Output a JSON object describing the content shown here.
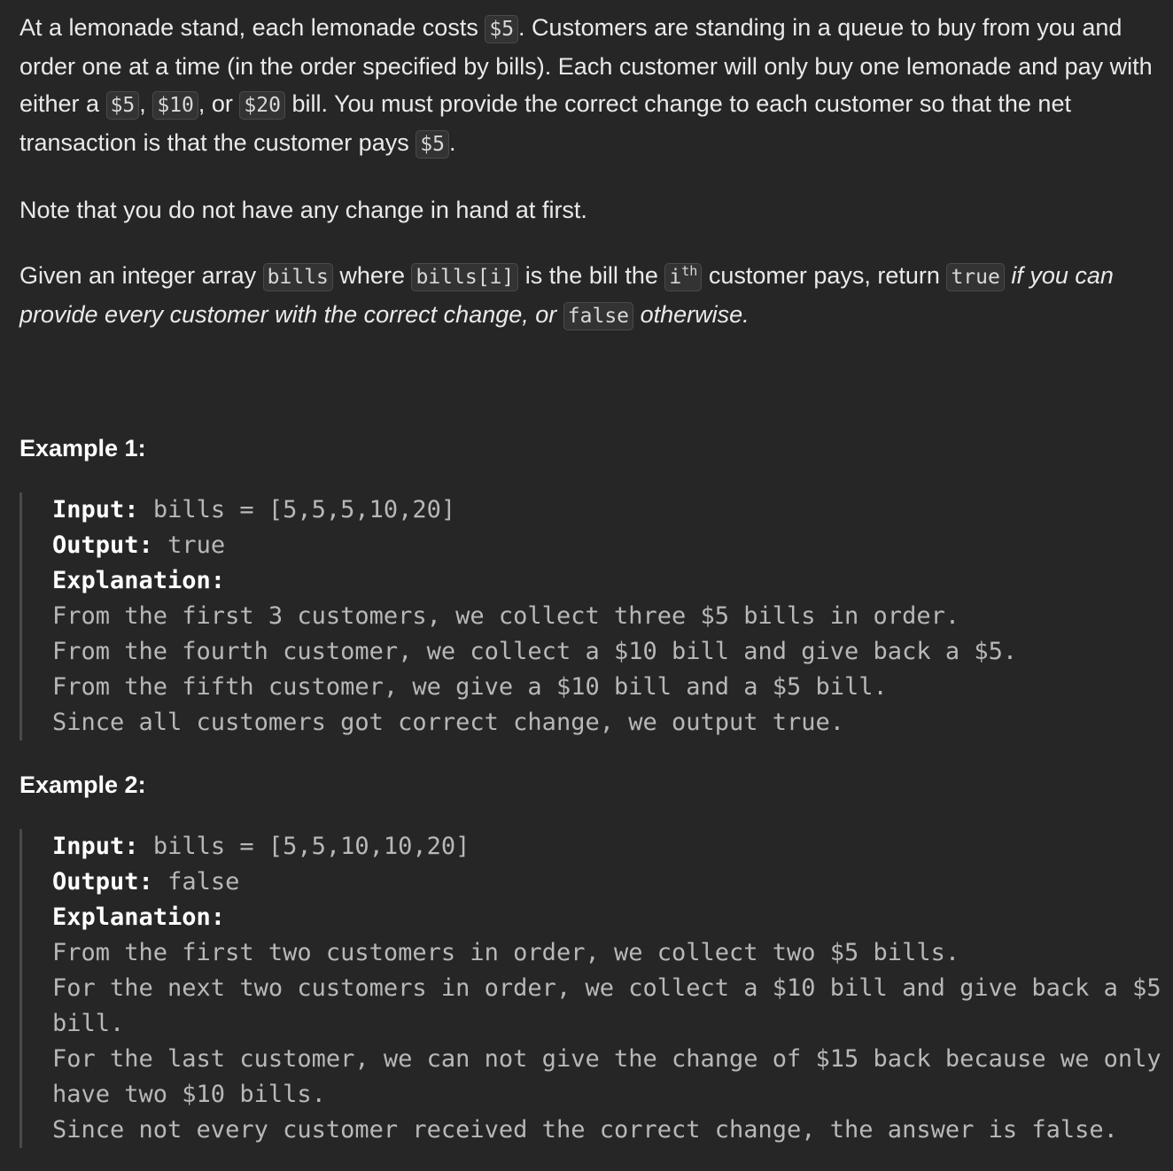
{
  "description": {
    "p1": {
      "t1": "At a lemonade stand, each lemonade costs",
      "c1": "$5",
      "t2": ". Customers are standing in a queue to buy from you and order one at a time (in the order specified by bills). Each customer will only buy one lemonade and pay with either a",
      "c2": "$5",
      "t3": ",",
      "c3": "$10",
      "t4": ", or",
      "c4": "$20",
      "t5": "bill. You must provide the correct change to each customer so that the net transaction is that the customer pays",
      "c5": "$5",
      "t6": "."
    },
    "note": "Note that you do not have any change in hand at first.",
    "given": {
      "t1": "Given an integer array",
      "c1": "bills",
      "t2": "where",
      "c2": "bills[i]",
      "t3": "is the bill the",
      "c3_base": "i",
      "c3_sup": "th",
      "t4": "customer pays, return",
      "c4": "true",
      "t5": "if you can provide every customer with the correct change, or",
      "c5": "false",
      "t6": "otherwise."
    }
  },
  "examples": [
    {
      "title": "Example 1:",
      "input_label": "Input:",
      "input_value": "bills = [5,5,5,10,20]",
      "output_label": "Output:",
      "output_value": "true",
      "explanation_label": "Explanation:",
      "explanation": "From the first 3 customers, we collect three $5 bills in order.\nFrom the fourth customer, we collect a $10 bill and give back a $5.\nFrom the fifth customer, we give a $10 bill and a $5 bill.\nSince all customers got correct change, we output true."
    },
    {
      "title": "Example 2:",
      "input_label": "Input:",
      "input_value": "bills = [5,5,10,10,20]",
      "output_label": "Output:",
      "output_value": "false",
      "explanation_label": "Explanation:",
      "explanation": "From the first two customers in order, we collect two $5 bills.\nFor the next two customers in order, we collect a $10 bill and give back a $5 bill.\nFor the last customer, we can not give the change of $15 back because we only have two $10 bills.\nSince not every customer received the correct change, the answer is false."
    }
  ]
}
